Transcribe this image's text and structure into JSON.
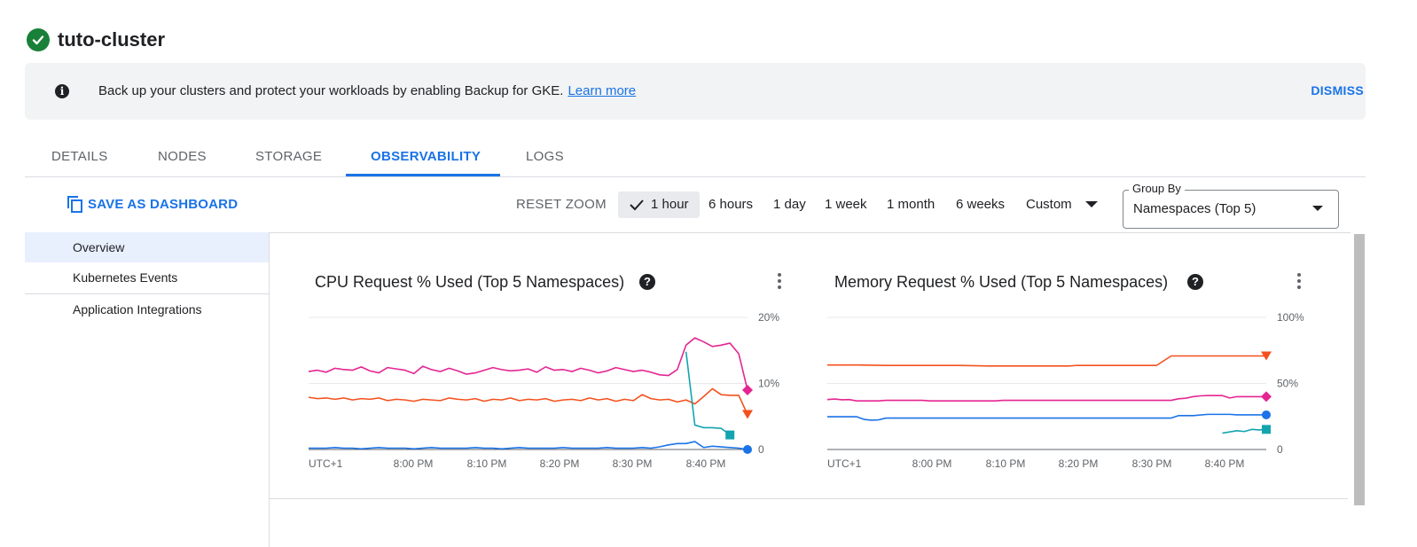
{
  "header": {
    "title": "tuto-cluster",
    "status_icon": "check-circle-icon",
    "status_color": "#188038"
  },
  "banner": {
    "text": "Back up your clusters and protect your workloads by enabling Backup for GKE.",
    "link": "Learn more",
    "dismiss": "DISMISS"
  },
  "tabs": {
    "details": "DETAILS",
    "nodes": "NODES",
    "storage": "STORAGE",
    "observability": "OBSERVABILITY",
    "logs": "LOGS",
    "active": "OBSERVABILITY"
  },
  "toolbar": {
    "save": "SAVE AS DASHBOARD",
    "reset_zoom": "RESET ZOOM",
    "ranges": {
      "h1": "1 hour",
      "h6": "6 hours",
      "d1": "1 day",
      "w1": "1 week",
      "m1": "1 month",
      "w6": "6 weeks",
      "custom": "Custom"
    },
    "selected_range": "1 hour",
    "group_by_label": "Group By",
    "group_by_value": "Namespaces (Top 5)"
  },
  "sidenav": {
    "overview": "Overview",
    "events": "Kubernetes Events",
    "integrations": "Application Integrations",
    "selected": "Overview"
  },
  "accent": "#1a73e8",
  "chart_data": [
    {
      "type": "line",
      "title": "CPU Request % Used (Top 5 Namespaces)",
      "x_tick_labels": [
        "UTC+1",
        "8:00 PM",
        "8:10 PM",
        "8:20 PM",
        "8:30 PM",
        "8:40 PM"
      ],
      "y_tick_labels": [
        "20%",
        "10%",
        "0"
      ],
      "ylim": [
        0,
        20
      ],
      "x_range_minutes": [
        0,
        60
      ],
      "grid": true,
      "series": [
        {
          "color": "#e52592",
          "marker": "diamond",
          "values": [
            11.8,
            12.0,
            11.7,
            12.3,
            12.1,
            12.0,
            12.5,
            11.9,
            11.6,
            12.4,
            12.2,
            12.0,
            11.5,
            12.6,
            12.1,
            11.8,
            12.3,
            11.9,
            11.4,
            11.6,
            12.0,
            12.4,
            12.1,
            11.9,
            12.0,
            12.2,
            11.7,
            12.5,
            12.0,
            12.1,
            11.8,
            12.3,
            12.0,
            11.6,
            11.9,
            12.4,
            12.1,
            11.8,
            12.0,
            11.7,
            11.3,
            11.2,
            12.1,
            15.8,
            16.9,
            16.3,
            15.6,
            15.8,
            16.1,
            14.5,
            9.0
          ]
        },
        {
          "color": "#f4511e",
          "marker": "triangle",
          "values": [
            7.9,
            7.7,
            7.8,
            7.6,
            7.8,
            7.5,
            7.7,
            7.6,
            7.8,
            7.4,
            7.6,
            7.5,
            7.3,
            7.6,
            7.5,
            7.4,
            7.8,
            7.6,
            7.5,
            7.7,
            7.3,
            7.6,
            7.5,
            7.8,
            7.4,
            7.6,
            7.5,
            7.7,
            7.3,
            7.5,
            7.6,
            7.4,
            7.8,
            7.5,
            7.7,
            7.3,
            7.6,
            7.4,
            8.3,
            7.7,
            7.5,
            7.6,
            7.2,
            7.5,
            6.9,
            8.0,
            9.2,
            8.3,
            8.2,
            8.2,
            5.3
          ]
        },
        {
          "color": "#12a4af",
          "marker": "square",
          "x_start_index": 43,
          "values": [
            14.8,
            3.7,
            3.3,
            3.3,
            3.2,
            2.2
          ]
        },
        {
          "color": "#1a73e8",
          "marker": "circle",
          "values": [
            0.2,
            0.2,
            0.2,
            0.3,
            0.2,
            0.2,
            0.1,
            0.2,
            0.3,
            0.2,
            0.2,
            0.2,
            0.1,
            0.2,
            0.3,
            0.2,
            0.2,
            0.2,
            0.2,
            0.3,
            0.2,
            0.2,
            0.1,
            0.2,
            0.3,
            0.2,
            0.2,
            0.2,
            0.2,
            0.3,
            0.2,
            0.2,
            0.2,
            0.2,
            0.3,
            0.2,
            0.2,
            0.2,
            0.3,
            0.2,
            0.4,
            0.7,
            0.9,
            0.9,
            1.2,
            0.3,
            0.5,
            0.4,
            0.3,
            0.2,
            0.0
          ]
        }
      ]
    },
    {
      "type": "line",
      "title": "Memory Request % Used (Top 5 Namespaces)",
      "x_tick_labels": [
        "UTC+1",
        "8:00 PM",
        "8:10 PM",
        "8:20 PM",
        "8:30 PM",
        "8:40 PM"
      ],
      "y_tick_labels": [
        "100%",
        "50%",
        "0"
      ],
      "ylim": [
        0,
        100
      ],
      "x_range_minutes": [
        0,
        60
      ],
      "grid": true,
      "series": [
        {
          "color": "#f4511e",
          "marker": "triangle",
          "points": [
            [
              0,
              64
            ],
            [
              4,
              64
            ],
            [
              8,
              63.6
            ],
            [
              18,
              63.6
            ],
            [
              22,
              63.2
            ],
            [
              33,
              63.2
            ],
            [
              34,
              63.6
            ],
            [
              45,
              63.6
            ],
            [
              47,
              70.8
            ],
            [
              60,
              70.8
            ]
          ]
        },
        {
          "color": "#e52592",
          "marker": "diamond",
          "points": [
            [
              0,
              37.8
            ],
            [
              1,
              38.2
            ],
            [
              2,
              37.6
            ],
            [
              3,
              37.8
            ],
            [
              4,
              36.8
            ],
            [
              7,
              36.8
            ],
            [
              8,
              37.2
            ],
            [
              13,
              37.2
            ],
            [
              14,
              36.8
            ],
            [
              23,
              36.8
            ],
            [
              24,
              37.2
            ],
            [
              47,
              37.2
            ],
            [
              48,
              38.4
            ],
            [
              49,
              38.8
            ],
            [
              50,
              40.0
            ],
            [
              51,
              40.6
            ],
            [
              52,
              40.8
            ],
            [
              54,
              40.8
            ],
            [
              55,
              39.0
            ],
            [
              56,
              40.0
            ],
            [
              60,
              40.0
            ]
          ]
        },
        {
          "color": "#1a73e8",
          "marker": "circle",
          "points": [
            [
              0,
              24.8
            ],
            [
              4,
              24.8
            ],
            [
              5,
              22.8
            ],
            [
              6,
              22.2
            ],
            [
              7,
              22.4
            ],
            [
              8,
              23.8
            ],
            [
              47,
              23.8
            ],
            [
              48,
              25.6
            ],
            [
              50,
              25.6
            ],
            [
              52,
              26.6
            ],
            [
              55,
              26.6
            ],
            [
              56,
              26.2
            ],
            [
              60,
              26.2
            ]
          ]
        },
        {
          "color": "#12a4af",
          "marker": "square",
          "points": [
            [
              54,
              12.4
            ],
            [
              56,
              14.2
            ],
            [
              57,
              13.6
            ],
            [
              58,
              15.2
            ],
            [
              59,
              14.8
            ],
            [
              60,
              15.2
            ]
          ]
        }
      ]
    }
  ]
}
